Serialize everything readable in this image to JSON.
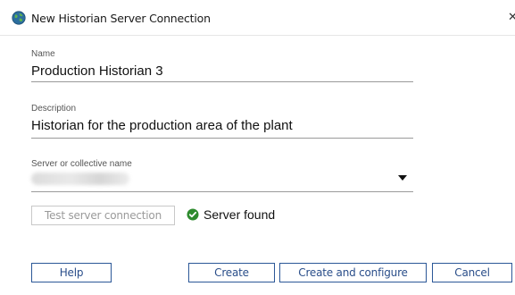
{
  "window": {
    "title": "New Historian Server Connection",
    "close_glyph": "✕"
  },
  "form": {
    "name": {
      "label": "Name",
      "value": "Production Historian 3"
    },
    "description": {
      "label": "Description",
      "value": "Historian for the production area of the plant"
    },
    "server": {
      "label": "Server or collective name"
    }
  },
  "test": {
    "button_label": "Test server connection",
    "status_text": "Server found",
    "status_color": "#2e8b2e"
  },
  "buttons": {
    "help": "Help",
    "create": "Create",
    "create_configure": "Create and configure",
    "cancel": "Cancel"
  },
  "icons": {
    "app": "globe-icon",
    "status": "check-circle-icon",
    "dropdown": "caret-down-icon"
  }
}
